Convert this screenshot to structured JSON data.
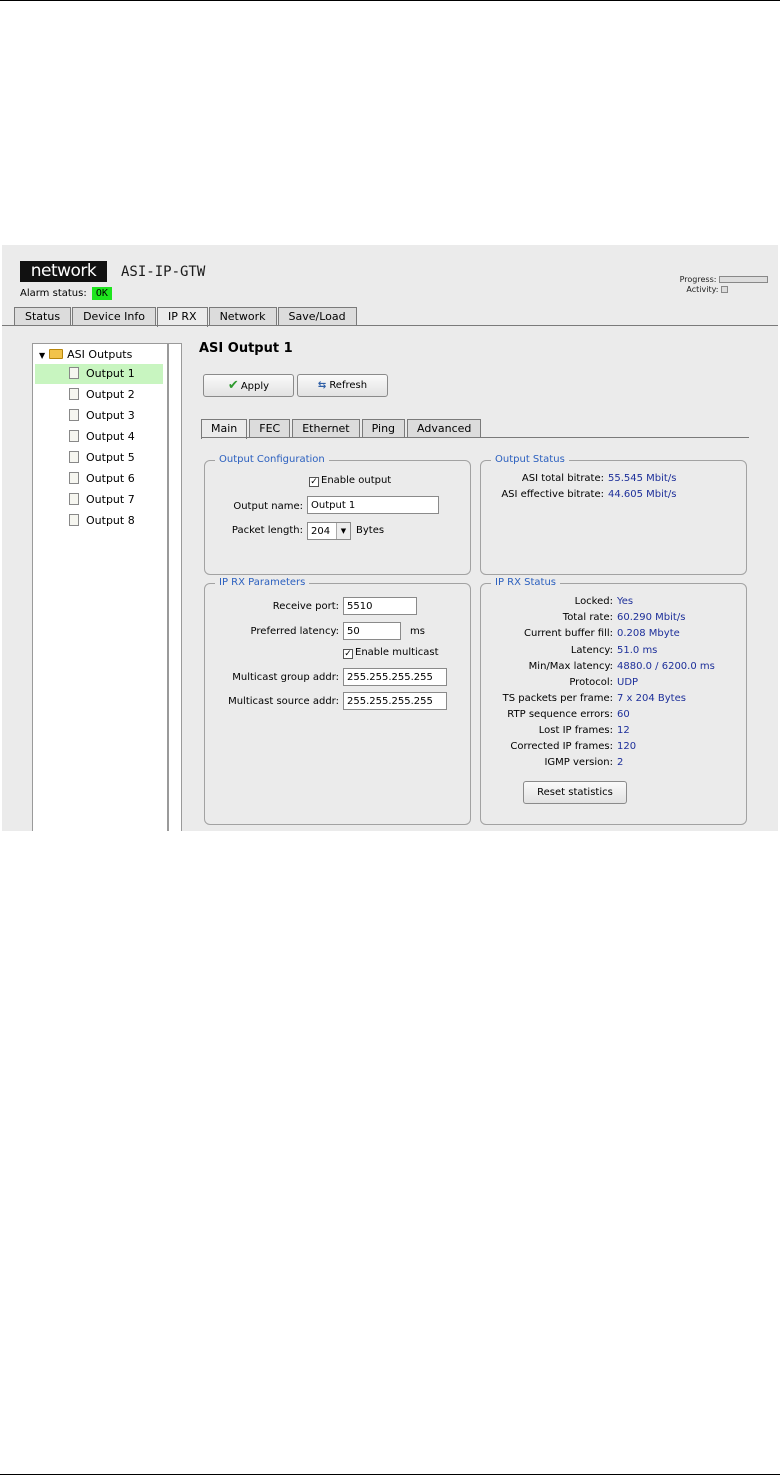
{
  "header": {
    "logo": "network",
    "device": "ASI-IP-GTW",
    "alarm_label": "Alarm status:",
    "alarm_value": "OK",
    "progress_label": "Progress:",
    "activity_label": "Activity:"
  },
  "tabs": [
    "Status",
    "Device Info",
    "IP RX",
    "Network",
    "Save/Load"
  ],
  "tree": {
    "root": "ASI Outputs",
    "items": [
      "Output 1",
      "Output 2",
      "Output 3",
      "Output 4",
      "Output 5",
      "Output 6",
      "Output 7",
      "Output 8"
    ]
  },
  "main": {
    "title": "ASI Output 1",
    "apply": "Apply",
    "refresh": "Refresh",
    "subtabs": [
      "Main",
      "FEC",
      "Ethernet",
      "Ping",
      "Advanced"
    ]
  },
  "output_config": {
    "legend": "Output Configuration",
    "enable_label": "Enable output",
    "name_label": "Output name:",
    "name_value": "Output 1",
    "packet_label": "Packet length:",
    "packet_value": "204",
    "packet_unit": "Bytes"
  },
  "output_status": {
    "legend": "Output Status",
    "total_label": "ASI total bitrate:",
    "total_value": "55.545 Mbit/s",
    "eff_label": "ASI effective bitrate:",
    "eff_value": "44.605 Mbit/s"
  },
  "ip_rx_params": {
    "legend": "IP RX Parameters",
    "port_label": "Receive port:",
    "port_value": "5510",
    "latency_label": "Preferred latency:",
    "latency_value": "50",
    "latency_unit": "ms",
    "multicast_label": "Enable multicast",
    "group_label": "Multicast group addr:",
    "group_value": "255.255.255.255",
    "source_label": "Multicast source addr:",
    "source_value": "255.255.255.255"
  },
  "ip_rx_status": {
    "legend": "IP RX Status",
    "rows": [
      {
        "label": "Locked:",
        "value": "Yes"
      },
      {
        "label": "Total rate:",
        "value": "60.290 Mbit/s"
      },
      {
        "label": "Current buffer fill:",
        "value": "0.208 Mbyte"
      },
      {
        "label": "Latency:",
        "value": "51.0 ms"
      },
      {
        "label": "Min/Max latency:",
        "value": "4880.0 / 6200.0 ms"
      },
      {
        "label": "Protocol:",
        "value": "UDP"
      },
      {
        "label": "TS packets per frame:",
        "value": "7 x 204 Bytes"
      },
      {
        "label": "RTP sequence errors:",
        "value": "60"
      },
      {
        "label": "Lost IP frames:",
        "value": "12"
      },
      {
        "label": "Corrected IP frames:",
        "value": "120"
      },
      {
        "label": "IGMP version:",
        "value": "2"
      }
    ],
    "reset": "Reset statistics"
  }
}
